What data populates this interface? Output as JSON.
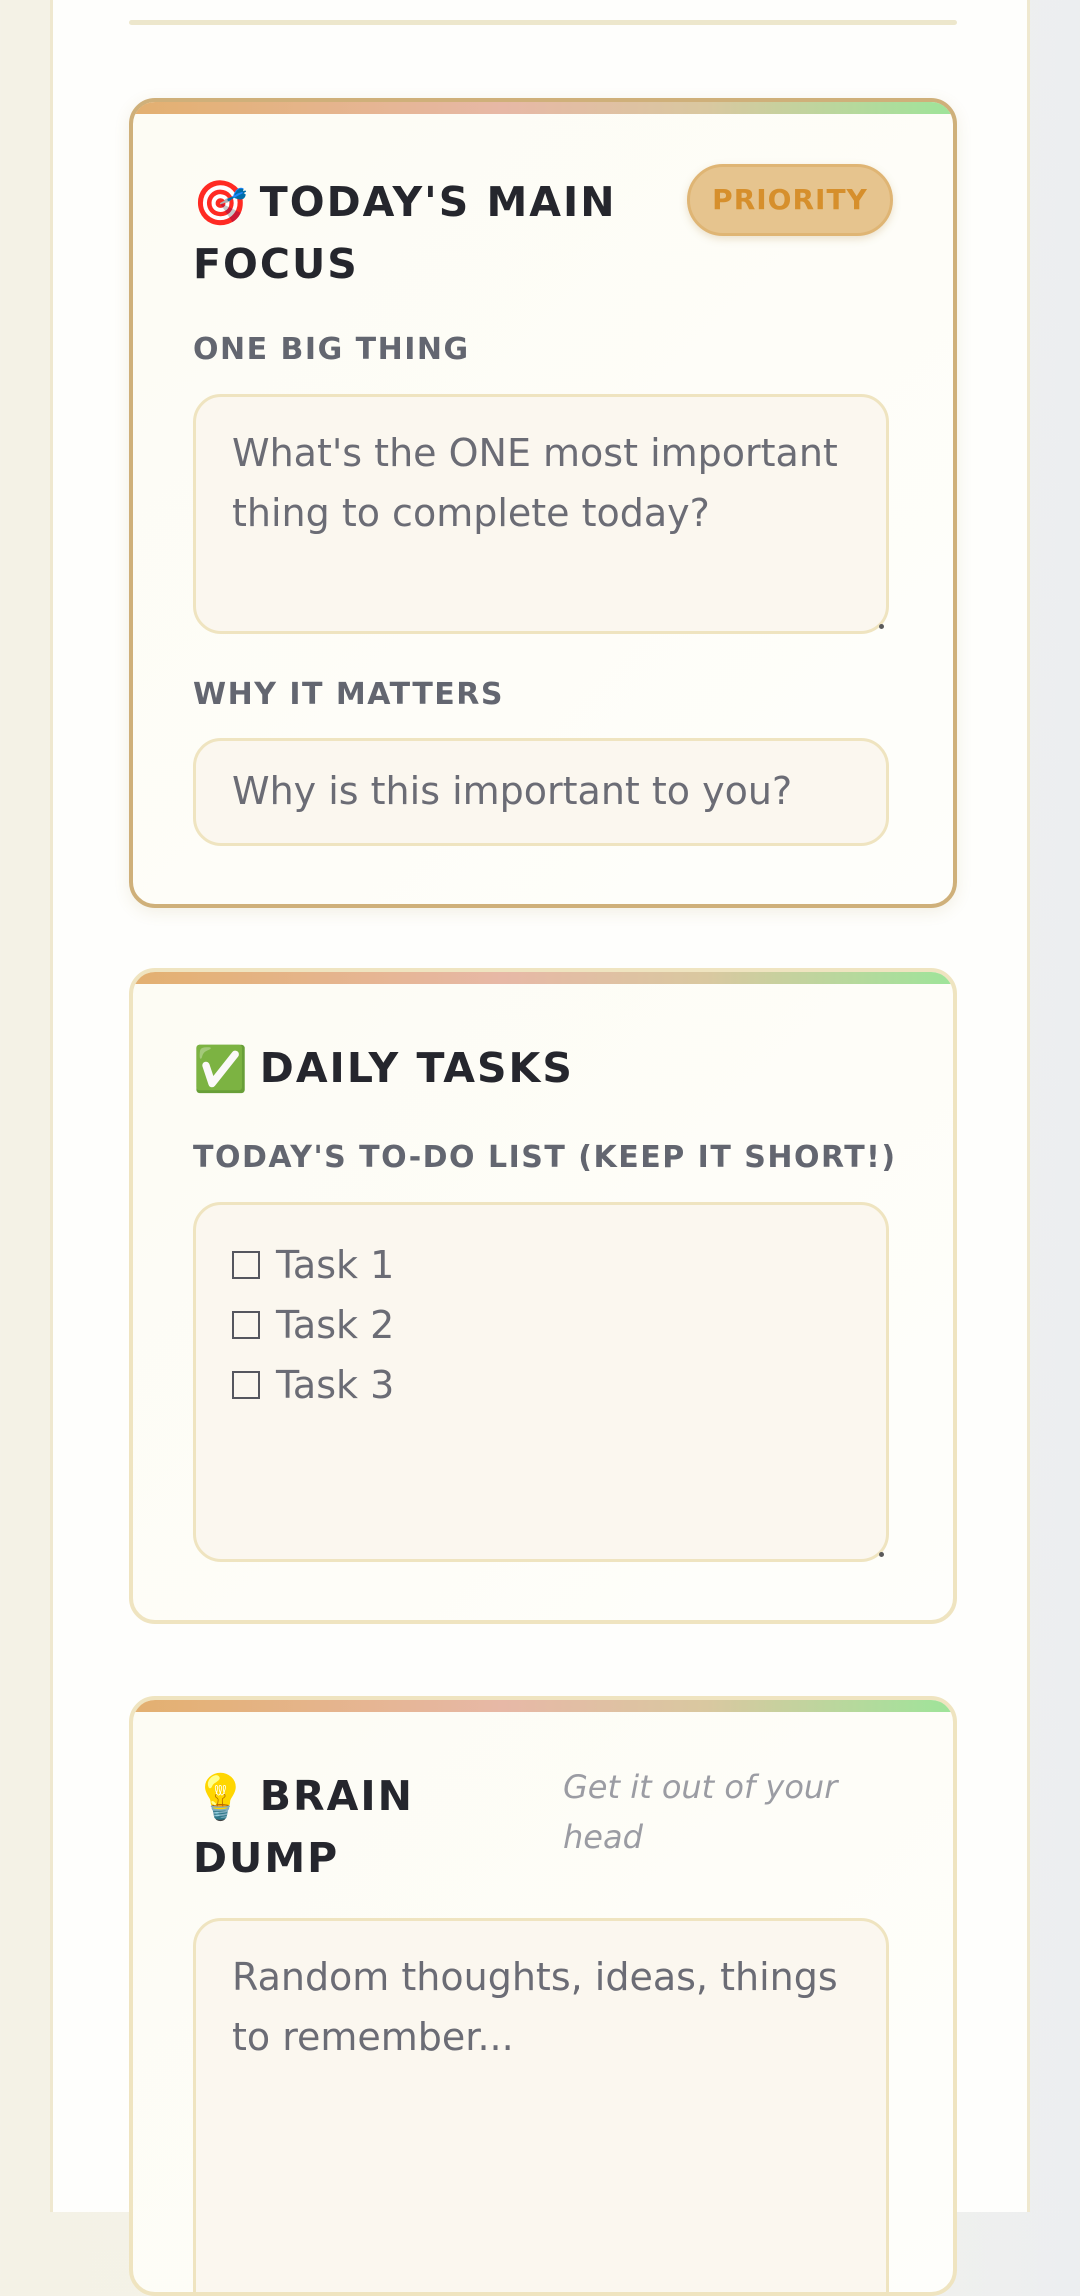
{
  "focus": {
    "emoji": "🎯",
    "title": "TODAY'S MAIN FOCUS",
    "badge": "PRIORITY",
    "one_big_thing_label": "ONE BIG THING",
    "one_big_thing_placeholder": "What's the ONE most important thing to complete today?",
    "why_label": "WHY IT MATTERS",
    "why_placeholder": "Why is this important to you?"
  },
  "tasks": {
    "emoji": "✅",
    "title": "DAILY TASKS",
    "list_label": "TODAY'S TO-DO LIST (KEEP IT SHORT!)",
    "items": [
      "Task 1",
      "Task 2",
      "Task 3"
    ]
  },
  "brain": {
    "emoji": "💡",
    "title": "BRAIN DUMP",
    "hint": "Get it out of your head",
    "placeholder": "Random thoughts, ideas, things to remember..."
  },
  "colors": {
    "accent": "#e3b070",
    "priority_badge": "#e6c48e",
    "stripe_end": "#9ee49a"
  }
}
